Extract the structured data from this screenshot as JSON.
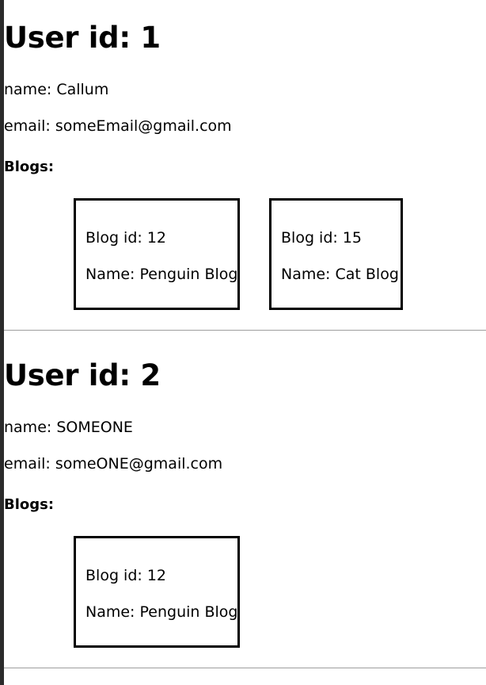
{
  "users": [
    {
      "title": "User id: 1",
      "name_line": "name: Callum",
      "email_line": "email: someEmail@gmail.com",
      "blogs_label": "Blogs:",
      "blogs": [
        {
          "id_line": "Blog id: 12",
          "name_line": "Name: Penguin Blog"
        },
        {
          "id_line": "Blog id: 15",
          "name_line": "Name: Cat Blog"
        }
      ]
    },
    {
      "title": "User id: 2",
      "name_line": "name: SOMEONE",
      "email_line": "email: someONE@gmail.com",
      "blogs_label": "Blogs:",
      "blogs": [
        {
          "id_line": "Blog id: 12",
          "name_line": "Name: Penguin Blog"
        }
      ]
    }
  ]
}
